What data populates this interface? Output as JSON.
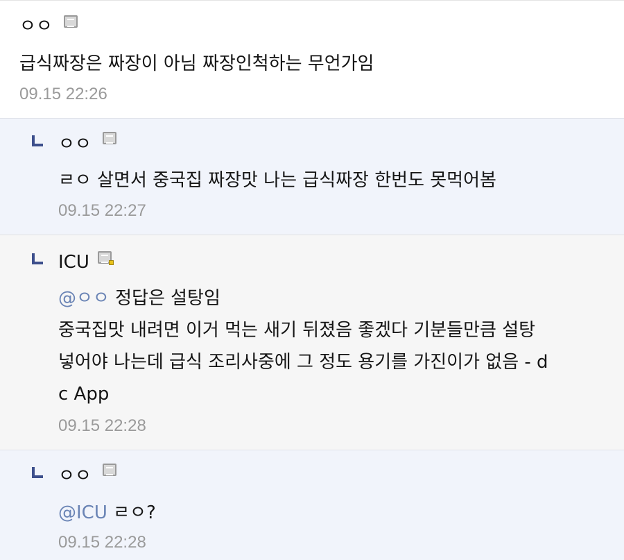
{
  "comments": [
    {
      "author": "ㅇㅇ",
      "text": "급식짜장은 짜장이 아님 짜장인척하는 무언가임",
      "time": "09.15 22:26"
    },
    {
      "author": "ㅇㅇ",
      "text": "ㄹㅇ 살면서 중국집 짜장맛 나는 급식짜장 한번도 못먹어봄",
      "time": "09.15 22:27"
    },
    {
      "author": "ICU",
      "mention": "@ㅇㅇ",
      "lines": [
        "정답은 설탕임",
        "중국집맛 내려면 이거 먹는 새기 뒤졌음 좋겠다 기분들만큼 설탕",
        "넣어야 나는데 급식 조리사중에 그 정도 용기를 가진이가 없음 - d",
        "c App"
      ],
      "time": "09.15 22:28"
    },
    {
      "author": "ㅇㅇ",
      "mention": "@ICU",
      "text": "ㄹㅇ?",
      "time": "09.15 22:28"
    }
  ],
  "icons": {
    "nick": "nickname-badge-icon",
    "reply": "reply-arrow-icon",
    "fixed_nick_dot_color": "#e8c21a"
  },
  "colors": {
    "reply_bg": "#f1f4fb",
    "alt_bg": "#f6f6f6",
    "mention": "#6a84b5",
    "timestamp": "#9a9a9a"
  }
}
